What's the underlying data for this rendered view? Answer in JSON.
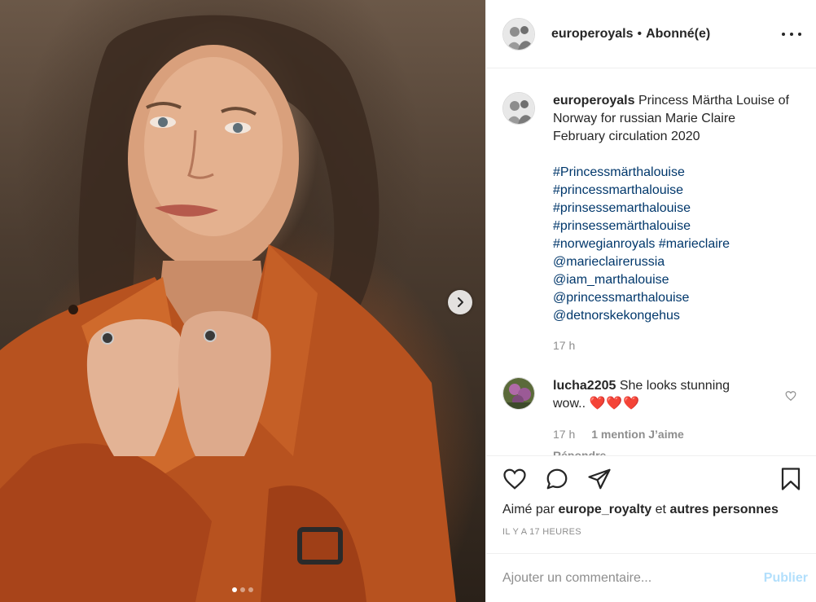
{
  "post": {
    "image_alt": "",
    "carousel_dots": 3,
    "active_dot": 0
  },
  "header": {
    "username": "europeroyals",
    "separator": "•",
    "follow_status": "Abonné(e)"
  },
  "caption": {
    "username": "europeroyals",
    "text": "Princess Märtha Louise of Norway for russian Marie Claire February circulation 2020",
    "tags": [
      "#Princessmärthalouise",
      "#princessmarthalouise",
      "#prinsessemarthalouise",
      "#prinsessemärthalouise",
      "#norwegianroyals #marieclaire",
      "@marieclairerussia",
      "@iam_marthalouise",
      "@princessmarthalouise",
      "@detnorskekongehus"
    ],
    "age": "17 h"
  },
  "comment": {
    "username": "lucha2205",
    "text": "She looks stunning wow..",
    "emoji": "❤️❤️❤️",
    "age": "17 h",
    "likes": "1 mention J’aime",
    "reply": "Répondre"
  },
  "actions": {
    "liked_by_prefix": "Aimé par",
    "liked_by_user": "europe_royalty",
    "liked_by_and": "et",
    "liked_by_others": "autres personnes",
    "timestamp": "IL Y A 17 HEURES"
  },
  "add_comment": {
    "placeholder": "Ajouter un commentaire...",
    "post_label": "Publier"
  },
  "colors": {
    "link": "#00376b",
    "muted": "#8e8e8e",
    "post_disabled": "#b2dffc",
    "heart": "#e0245e"
  }
}
